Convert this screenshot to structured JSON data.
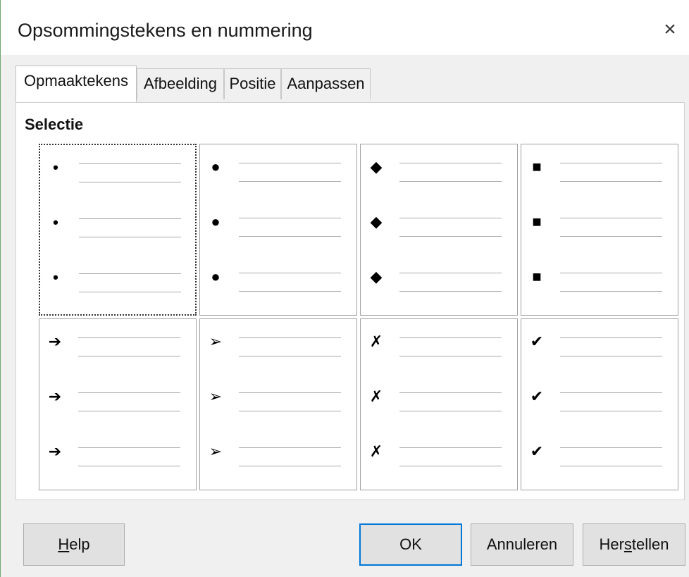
{
  "dialog": {
    "title": "Opsommingstekens en nummering",
    "close_glyph": "×"
  },
  "tabs": [
    {
      "label": "Opmaaktekens",
      "active": true
    },
    {
      "label": "Afbeelding",
      "active": false
    },
    {
      "label": "Positie",
      "active": false
    },
    {
      "label": "Aanpassen",
      "active": false
    }
  ],
  "selection": {
    "title": "Selectie",
    "styles": [
      {
        "symbol": "•",
        "icon": "small-bullet-icon",
        "selected": true
      },
      {
        "symbol": "●",
        "icon": "large-bullet-icon",
        "selected": false
      },
      {
        "symbol": "◆",
        "icon": "diamond-bullet-icon",
        "selected": false
      },
      {
        "symbol": "■",
        "icon": "square-bullet-icon",
        "selected": false
      },
      {
        "symbol": "➔",
        "icon": "arrow-bullet-icon",
        "selected": false
      },
      {
        "symbol": "➢",
        "icon": "arrowhead-bullet-icon",
        "selected": false
      },
      {
        "symbol": "✗",
        "icon": "cross-bullet-icon",
        "selected": false
      },
      {
        "symbol": "✔",
        "icon": "checkmark-bullet-icon",
        "selected": false
      }
    ]
  },
  "buttons": {
    "help": {
      "pre": "",
      "mnemonic": "H",
      "post": "elp"
    },
    "ok": "OK",
    "cancel": "Annuleren",
    "reset": {
      "pre": "Her",
      "mnemonic": "s",
      "post": "tellen"
    }
  }
}
